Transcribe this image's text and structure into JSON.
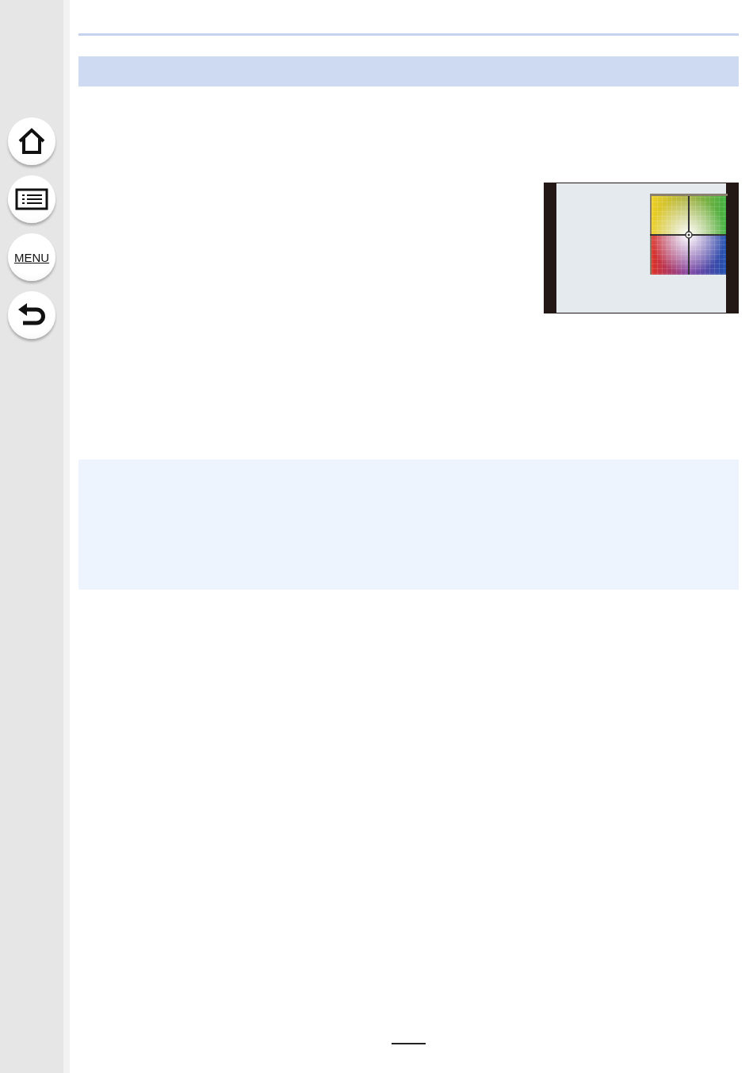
{
  "sidebar": {
    "buttons": [
      {
        "kind": "home"
      },
      {
        "kind": "contents"
      },
      {
        "kind": "menu",
        "label": "MENU"
      },
      {
        "kind": "back"
      }
    ]
  }
}
